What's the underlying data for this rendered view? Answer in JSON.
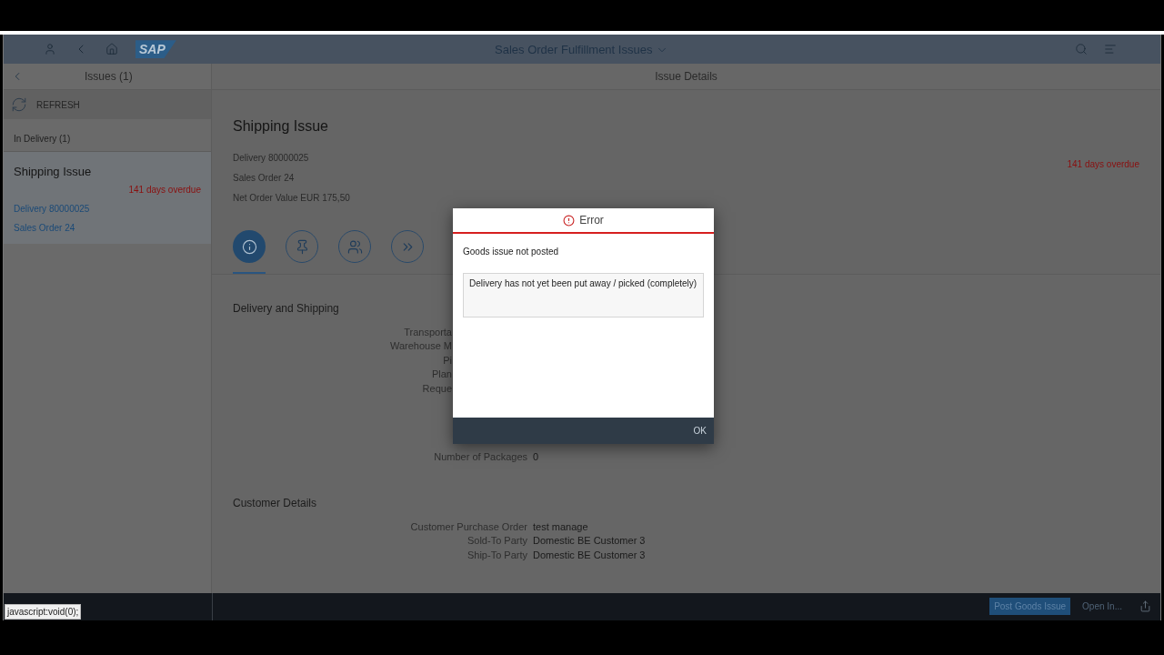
{
  "shell": {
    "logo": "SAP",
    "title": "Sales Order Fulfillment Issues"
  },
  "master": {
    "title": "Issues (1)",
    "refresh": "REFRESH",
    "group": "In Delivery (1)",
    "items": [
      {
        "title": "Shipping Issue",
        "status": "141 days overdue",
        "links": [
          "Delivery 80000025",
          "Sales Order 24"
        ],
        "selected": true
      }
    ]
  },
  "detail": {
    "title": "Issue Details",
    "header": {
      "title": "Shipping Issue",
      "attributes": [
        "Delivery 80000025",
        "Sales Order 24",
        "Net Order Value EUR 175,50"
      ],
      "status": "141 days overdue"
    },
    "tabs": [
      {
        "kind": "info",
        "selected": true
      },
      {
        "kind": "pin",
        "selected": false
      },
      {
        "kind": "people",
        "selected": false
      },
      {
        "kind": "forward",
        "selected": false
      }
    ],
    "sections": [
      {
        "title": "Delivery and Shipping",
        "fields": [
          {
            "label": "Transporta"
          },
          {
            "label": "Warehouse M"
          },
          {
            "label": "Pi"
          },
          {
            "label": "Plan"
          },
          {
            "label": "Reque"
          },
          {
            "label": "Number of Packages",
            "value": "0"
          }
        ]
      },
      {
        "title": "Customer Details",
        "fields": [
          {
            "label": "Customer Purchase Order",
            "value": "test manage"
          },
          {
            "label": "Sold-To Party",
            "value": "Domestic BE Customer 3"
          },
          {
            "label": "Ship-To Party",
            "value": "Domestic BE Customer 3"
          }
        ]
      }
    ]
  },
  "footer": {
    "buttons": [
      {
        "label": "Post Goods Issue",
        "kind": "emphasized"
      },
      {
        "label": "Open In...",
        "kind": "plain"
      }
    ]
  },
  "dialog": {
    "title": "Error",
    "message": "Goods issue not posted",
    "details": "Delivery has not yet been put away / picked (completely)",
    "button": "OK"
  },
  "status_tip": "javascript:void(0);"
}
